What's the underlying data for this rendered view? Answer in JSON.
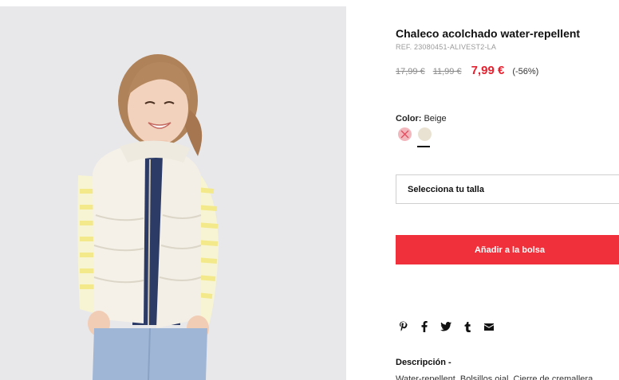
{
  "product": {
    "image_alt": "",
    "title": "Chaleco acolchado water-repellent",
    "ref": "REF. 23080451-ALIVEST2-LA",
    "price_original": "17,99 €",
    "price_previous": "11,99 €",
    "price_current": "7,99 €",
    "discount": "(-56%)",
    "color_label": "Color:",
    "color_value": "Beige",
    "swatches": [
      {
        "name": "pink",
        "color": "#f2b6bd",
        "available": false
      },
      {
        "name": "beige",
        "color": "#e9e2d2",
        "available": true,
        "selected": true
      }
    ],
    "size_placeholder": "Selecciona tu talla",
    "add_to_bag": "Añadir a la bolsa",
    "share_icons": [
      "pinterest-icon",
      "facebook-icon",
      "twitter-icon",
      "tumblr-icon",
      "email-icon"
    ],
    "description_title": "Descripción  -",
    "description_text": "Water-repellent. Bolsillos ojal. Cierre de cremallera."
  },
  "colors": {
    "accent": "#f0303a",
    "price_red": "#e6212f"
  }
}
